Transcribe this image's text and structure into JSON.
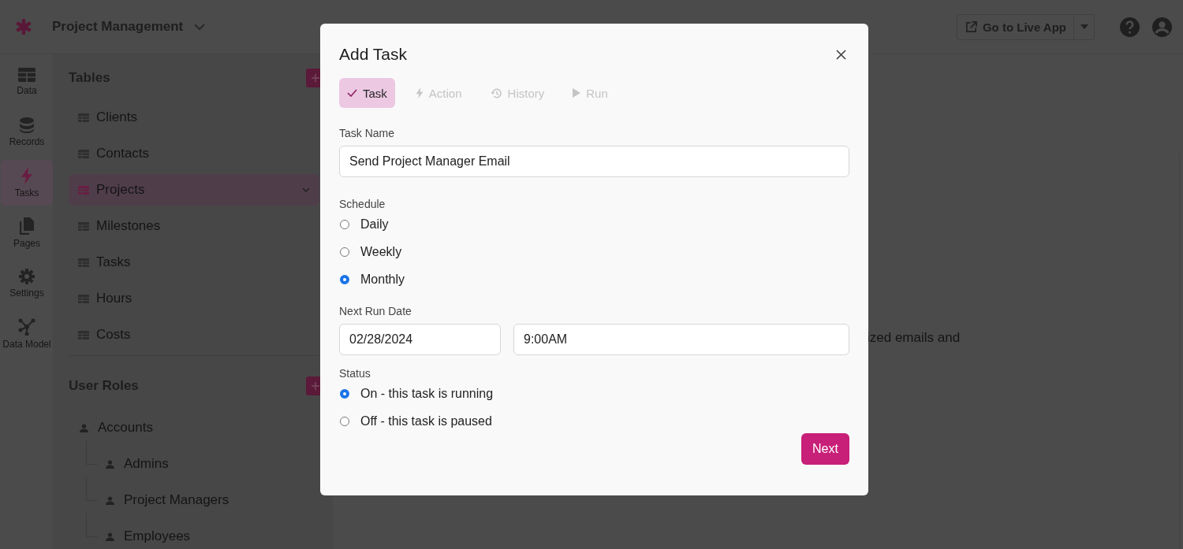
{
  "app": {
    "title": "Project Management"
  },
  "header": {
    "live_app_button": "Go to Live App"
  },
  "nav_rail": [
    {
      "label": "Data",
      "selected": false
    },
    {
      "label": "Records",
      "selected": false
    },
    {
      "label": "Tasks",
      "selected": true
    },
    {
      "label": "Pages",
      "selected": false
    },
    {
      "label": "Settings",
      "selected": false
    },
    {
      "label": "Data Model",
      "selected": false
    }
  ],
  "tables": {
    "title": "Tables",
    "items": [
      {
        "label": "Clients",
        "selected": false
      },
      {
        "label": "Contacts",
        "selected": false
      },
      {
        "label": "Projects",
        "selected": true
      },
      {
        "label": "Milestones",
        "selected": false
      },
      {
        "label": "Tasks",
        "selected": false
      },
      {
        "label": "Hours",
        "selected": false
      },
      {
        "label": "Costs",
        "selected": false
      }
    ]
  },
  "user_roles": {
    "title": "User Roles",
    "items": [
      {
        "label": "Accounts",
        "children": [
          {
            "label": "Admins"
          },
          {
            "label": "Project Managers"
          },
          {
            "label": "Employees"
          }
        ]
      }
    ]
  },
  "main": {
    "text_fragment": "ized emails and"
  },
  "dialog": {
    "title": "Add Task",
    "steps": [
      {
        "label": "Task",
        "selected": true
      },
      {
        "label": "Action",
        "selected": false
      },
      {
        "label": "History",
        "selected": false
      },
      {
        "label": "Run",
        "selected": false
      }
    ],
    "task_name": {
      "label": "Task Name",
      "value": "Send Project Manager Email"
    },
    "schedule": {
      "label": "Schedule",
      "options": [
        {
          "label": "Daily",
          "selected": false
        },
        {
          "label": "Weekly",
          "selected": false
        },
        {
          "label": "Monthly",
          "selected": true
        }
      ]
    },
    "next_run_date": {
      "label": "Next Run Date",
      "date": "02/28/2024",
      "time": "9:00AM"
    },
    "status": {
      "label": "Status",
      "options": [
        {
          "label": "On - this task is running",
          "selected": true
        },
        {
          "label": "Off - this task is paused",
          "selected": false
        }
      ]
    },
    "next_button": "Next"
  }
}
